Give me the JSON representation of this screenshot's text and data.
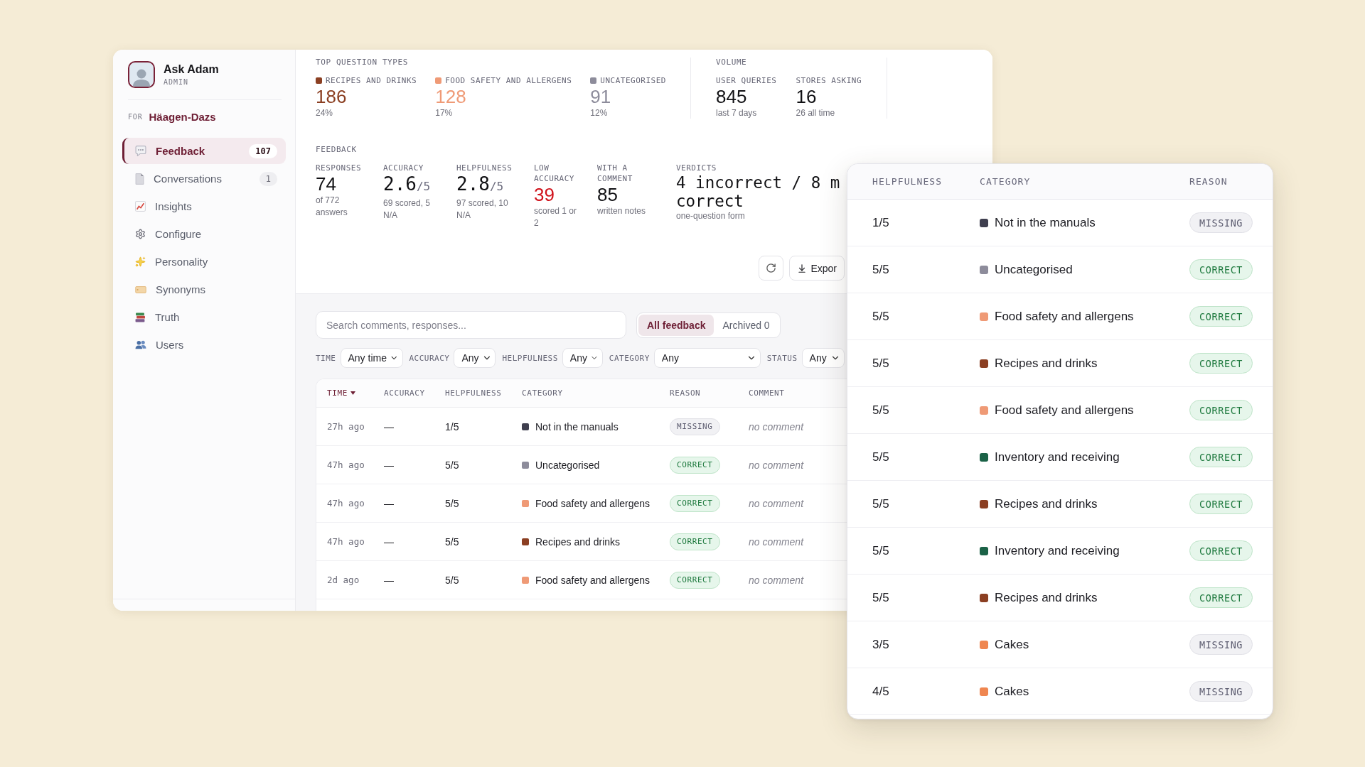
{
  "app": {
    "name": "Ask Adam",
    "role": "ADMIN",
    "for_label": "FOR",
    "tenant": "Häagen-Dazs"
  },
  "sidebar": {
    "items": [
      {
        "label": "Feedback",
        "count": "107",
        "selected": true
      },
      {
        "label": "Conversations",
        "count": "1",
        "selected": false
      },
      {
        "label": "Insights",
        "selected": false
      },
      {
        "label": "Configure",
        "selected": false
      },
      {
        "label": "Personality",
        "selected": false
      },
      {
        "label": "Synonyms",
        "selected": false
      },
      {
        "label": "Truth",
        "selected": false
      },
      {
        "label": "Users",
        "selected": false
      }
    ]
  },
  "top_question_types": {
    "title": "TOP QUESTION TYPES",
    "types": [
      {
        "label": "RECIPES AND DRINKS",
        "color": "#8b3f22",
        "value": "186",
        "share": "24%"
      },
      {
        "label": "FOOD SAFETY AND ALLERGENS",
        "color": "#ef9a76",
        "value": "128",
        "share": "17%"
      },
      {
        "label": "UNCATEGORISED",
        "color": "#8d8c9b",
        "value": "91",
        "share": "12%"
      }
    ]
  },
  "volume": {
    "title": "VOLUME",
    "stats": [
      {
        "label": "USER QUERIES",
        "value": "845",
        "note": "last 7 days"
      },
      {
        "label": "STORES ASKING",
        "value": "16",
        "note": "26 all time"
      }
    ]
  },
  "feedback": {
    "title": "FEEDBACK",
    "stats": [
      {
        "kind": "count",
        "label": "RESPONSES",
        "value": "74",
        "note": "of 772 answers"
      },
      {
        "kind": "score",
        "label": "ACCURACY",
        "value": "2.6",
        "suffix": "/5",
        "note": "69 scored, 5 N/A"
      },
      {
        "kind": "score",
        "label": "HELPFULNESS",
        "value": "2.8",
        "suffix": "/5",
        "note": "97 scored, 10 N/A"
      },
      {
        "kind": "alert",
        "label": "LOW ACCURACY",
        "value": "39",
        "note": "scored 1 or 2"
      },
      {
        "kind": "count",
        "label": "WITH A COMMENT",
        "value": "85",
        "note": "written notes"
      },
      {
        "kind": "verdict",
        "label": "VERDICTS",
        "value_lines": [
          "4 incorrect / 8 m",
          "correct"
        ],
        "note": "one-question form"
      }
    ]
  },
  "toolbar": {
    "export_label": "Expor"
  },
  "search": {
    "placeholder": "Search comments, responses...",
    "tabs": [
      {
        "label": "All feedback",
        "selected": true
      },
      {
        "label": "Archived 0",
        "selected": false
      }
    ]
  },
  "filters": [
    {
      "label": "TIME",
      "value": "Any time"
    },
    {
      "label": "ACCURACY",
      "value": "Any"
    },
    {
      "label": "HELPFULNESS",
      "value": "Any"
    },
    {
      "label": "CATEGORY",
      "value": "Any"
    },
    {
      "label": "STATUS",
      "value": "Any"
    }
  ],
  "feedback_table": {
    "columns": [
      {
        "label": "TIME",
        "sorted": true
      },
      {
        "label": "ACCURACY",
        "sorted": false
      },
      {
        "label": "HELPFULNESS",
        "sorted": false
      },
      {
        "label": "CATEGORY",
        "sorted": false
      },
      {
        "label": "REASON",
        "sorted": false
      },
      {
        "label": "COMMENT",
        "sorted": false
      }
    ],
    "rows": [
      {
        "time": "27h ago",
        "accuracy": "—",
        "helpfulness": "1/5",
        "category": "Not in the manuals",
        "color": "#3f3f4f",
        "reason": {
          "label": "MISSING",
          "kind": "missing"
        },
        "comment": "no comment"
      },
      {
        "time": "47h ago",
        "accuracy": "—",
        "helpfulness": "5/5",
        "category": "Uncategorised",
        "color": "#8d8c9b",
        "reason": {
          "label": "CORRECT",
          "kind": "correct"
        },
        "comment": "no comment"
      },
      {
        "time": "47h ago",
        "accuracy": "—",
        "helpfulness": "5/5",
        "category": "Food safety and allergens",
        "color": "#ef9a76",
        "reason": {
          "label": "CORRECT",
          "kind": "correct"
        },
        "comment": "no comment"
      },
      {
        "time": "47h ago",
        "accuracy": "—",
        "helpfulness": "5/5",
        "category": "Recipes and drinks",
        "color": "#8b3f22",
        "reason": {
          "label": "CORRECT",
          "kind": "correct"
        },
        "comment": "no comment"
      },
      {
        "time": "2d ago",
        "accuracy": "—",
        "helpfulness": "5/5",
        "category": "Food safety and allergens",
        "color": "#ef9a76",
        "reason": {
          "label": "CORRECT",
          "kind": "correct"
        },
        "comment": "no comment"
      }
    ]
  },
  "detail_panel": {
    "columns": [
      "HELPFULNESS",
      "CATEGORY",
      "REASON"
    ],
    "rows": [
      {
        "helpfulness": "1/5",
        "category": "Not in the manuals",
        "color": "#3f3f4f",
        "reason": {
          "label": "MISSING",
          "kind": "missing"
        }
      },
      {
        "helpfulness": "5/5",
        "category": "Uncategorised",
        "color": "#8d8c9b",
        "reason": {
          "label": "CORRECT",
          "kind": "correct"
        }
      },
      {
        "helpfulness": "5/5",
        "category": "Food safety and allergens",
        "color": "#ef9a76",
        "reason": {
          "label": "CORRECT",
          "kind": "correct"
        }
      },
      {
        "helpfulness": "5/5",
        "category": "Recipes and drinks",
        "color": "#8b3f22",
        "reason": {
          "label": "CORRECT",
          "kind": "correct"
        }
      },
      {
        "helpfulness": "5/5",
        "category": "Food safety and allergens",
        "color": "#ef9a76",
        "reason": {
          "label": "CORRECT",
          "kind": "correct"
        }
      },
      {
        "helpfulness": "5/5",
        "category": "Inventory and receiving",
        "color": "#1b6247",
        "reason": {
          "label": "CORRECT",
          "kind": "correct"
        }
      },
      {
        "helpfulness": "5/5",
        "category": "Recipes and drinks",
        "color": "#8b3f22",
        "reason": {
          "label": "CORRECT",
          "kind": "correct"
        }
      },
      {
        "helpfulness": "5/5",
        "category": "Inventory and receiving",
        "color": "#1b6247",
        "reason": {
          "label": "CORRECT",
          "kind": "correct"
        }
      },
      {
        "helpfulness": "5/5",
        "category": "Recipes and drinks",
        "color": "#8b3f22",
        "reason": {
          "label": "CORRECT",
          "kind": "correct"
        }
      },
      {
        "helpfulness": "3/5",
        "category": "Cakes",
        "color": "#ef8650",
        "reason": {
          "label": "MISSING",
          "kind": "missing"
        }
      },
      {
        "helpfulness": "4/5",
        "category": "Cakes",
        "color": "#ef8650",
        "reason": {
          "label": "MISSING",
          "kind": "missing"
        }
      }
    ]
  }
}
